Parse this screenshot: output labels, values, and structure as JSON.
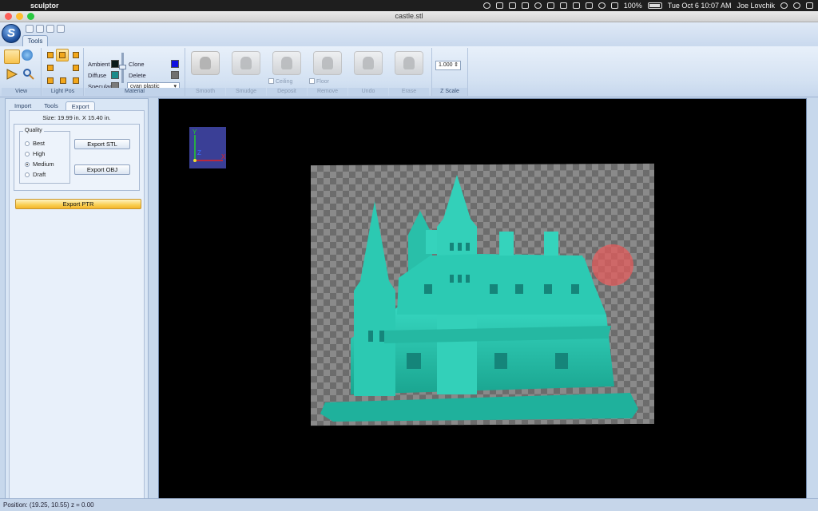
{
  "menubar": {
    "app_name": "sculptor",
    "battery": "100%",
    "datetime": "Tue Oct 6  10:07 AM",
    "user": "Joe Lovchik"
  },
  "window": {
    "title": "castle.stl"
  },
  "ribbon": {
    "tab": "Tools",
    "groups": {
      "view": "View",
      "light_pos": "Light Pos",
      "material": "Material",
      "z_scale": "Z Scale"
    },
    "material": {
      "ambient": "Ambient",
      "diffuse": "Diffuse",
      "specular": "Specular",
      "clone": "Clone",
      "delete": "Delete",
      "preset": "cyan plastic",
      "colors": {
        "ambient": "#0a1a1a",
        "diffuse": "#1a8a8a",
        "specular": "#7a7a7a",
        "clone": "#1010e0",
        "delete": "#707070"
      }
    },
    "tools": {
      "smooth": "Smooth",
      "smudge": "Smudge",
      "deposit": "Deposit",
      "ceiling": "Ceiling",
      "remove": "Remove",
      "floor": "Floor",
      "undo": "Undo",
      "erase": "Erase"
    },
    "zscale_value": "1.000"
  },
  "panel": {
    "tabs": [
      "Import",
      "Tools",
      "Export"
    ],
    "active_tab": "Export",
    "size_text": "Size: 19.99 in. X 15.40 in.",
    "quality_legend": "Quality",
    "quality_options": [
      "Best",
      "High",
      "Medium",
      "Draft"
    ],
    "quality_selected": "Medium",
    "export_stl": "Export STL",
    "export_obj": "Export OBJ",
    "export_ptr": "Export PTR"
  },
  "viewport": {
    "axis_labels": {
      "y": "Y",
      "x": "X",
      "z": "Z"
    },
    "model_color": "#27bfa9"
  },
  "status": {
    "position_text": "Position: (19.25, 10.55) z = 0.00"
  }
}
